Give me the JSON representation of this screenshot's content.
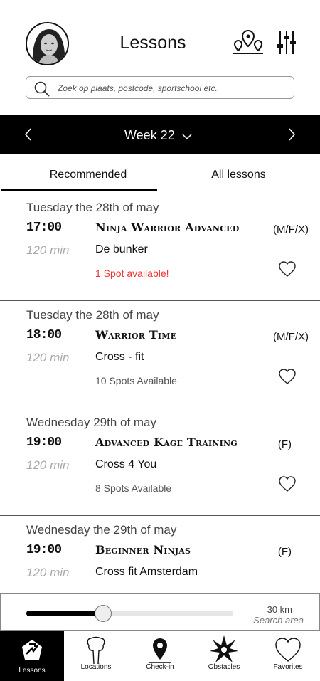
{
  "header": {
    "title": "Lessons",
    "search_placeholder": "Zoek op plaats, postcode, sportschool etc."
  },
  "week": {
    "label": "Week 22"
  },
  "tabs": [
    {
      "label": "Recommended",
      "active": true
    },
    {
      "label": "All lessons",
      "active": false
    }
  ],
  "lessons": [
    {
      "date": "Tuesday the 28th of may",
      "time": "17:00",
      "name": "Ninja Warrior Advanced",
      "gender": "(M/F/X)",
      "duration": "120 min",
      "location": "De bunker",
      "spots": "1 Spot available!"
    },
    {
      "date": "Tuesday the 28th of may",
      "time": "18:00",
      "name": "Warrior Time",
      "gender": "(M/F/X)",
      "duration": "120 min",
      "location": "Cross - fit",
      "spots": "10 Spots Available"
    },
    {
      "date": "Wednesday 29th of may",
      "time": "19:00",
      "name": "Advanced Kage Training",
      "gender": "(F)",
      "duration": "120 min",
      "location": "Cross 4 You",
      "spots": "8 Spots Available"
    },
    {
      "date": "Wednesday the 29th of may",
      "time": "19:00",
      "name": "Beginner Ninjas",
      "gender": "(F)",
      "duration": "120 min",
      "location": "Cross fit Amsterdam",
      "spots": ""
    }
  ],
  "search_area": {
    "value_label": "30 km",
    "label": "Search area",
    "fraction": 0.37
  },
  "nav": [
    {
      "label": "Lessons",
      "active": true
    },
    {
      "label": "Locations",
      "active": false
    },
    {
      "label": "Check-in",
      "active": false
    },
    {
      "label": "Obstacles",
      "active": false
    },
    {
      "label": "Favorites",
      "active": false
    }
  ],
  "colors": {
    "alert": "#e33333",
    "bar": "#000000"
  }
}
